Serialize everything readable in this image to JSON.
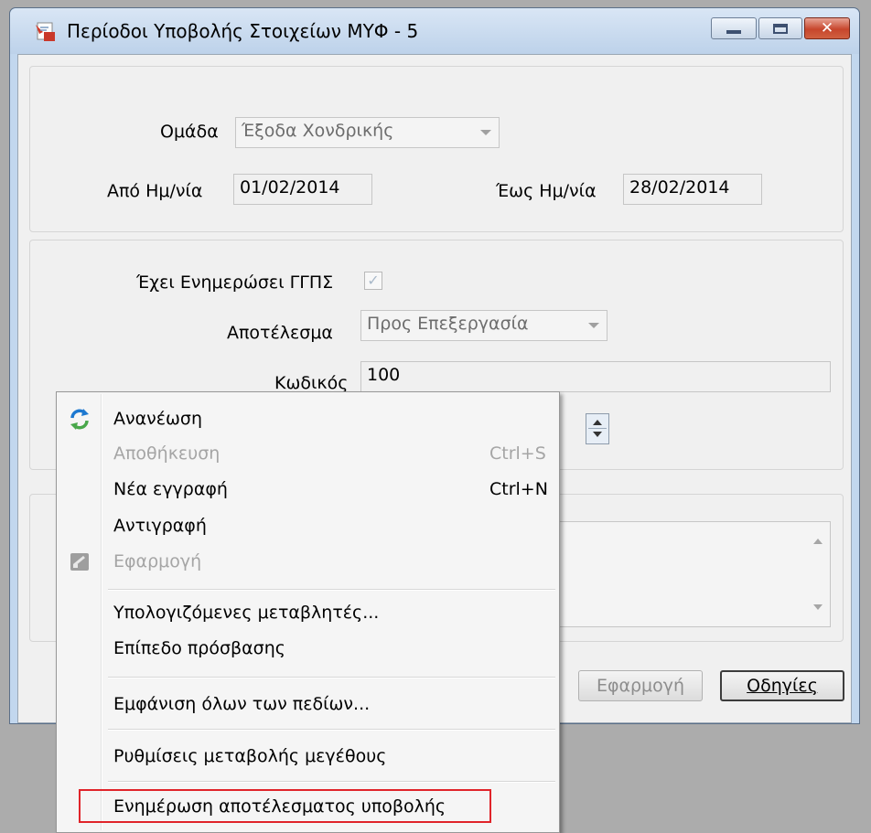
{
  "window": {
    "title": "Περίοδοι Υποβολής Στοιχείων ΜΥΦ - 5"
  },
  "form": {
    "group_label": "Ομάδα",
    "group_value": "Έξοδα Χονδρικής",
    "from_date_label": "Από Ημ/νία",
    "from_date_value": "01/02/2014",
    "to_date_label": "Έως Ημ/νία",
    "to_date_value": "28/02/2014",
    "updated_label": "Έχει Ενημερώσει ΓΓΠΣ",
    "updated_checked": true,
    "result_label": "Αποτέλεσμα",
    "result_value": "Προς Επεξεργασία",
    "code_label": "Κωδικός",
    "code_value": "100"
  },
  "buttons": {
    "apply_label": "Εφαρμογή",
    "help_label": "Οδηγίες"
  },
  "context_menu": {
    "items": [
      {
        "label": "Ανανέωση",
        "shortcut": "",
        "enabled": true,
        "icon": "refresh-icon"
      },
      {
        "label": "Αποθήκευση",
        "shortcut": "Ctrl+S",
        "enabled": false,
        "icon": ""
      },
      {
        "label": "Νέα εγγραφή",
        "shortcut": "Ctrl+N",
        "enabled": true,
        "icon": ""
      },
      {
        "label": "Αντιγραφή",
        "shortcut": "",
        "enabled": true,
        "icon": ""
      },
      {
        "label": "Εφαρμογή",
        "shortcut": "",
        "enabled": false,
        "icon": "apply-icon"
      },
      {
        "label": "Υπολογιζόμενες μεταβλητές...",
        "shortcut": "",
        "enabled": true,
        "icon": ""
      },
      {
        "label": "Επίπεδο πρόσβασης",
        "shortcut": "",
        "enabled": true,
        "icon": ""
      },
      {
        "label": "Εμφάνιση όλων των πεδίων...",
        "shortcut": "",
        "enabled": true,
        "icon": ""
      },
      {
        "label": "Ρυθμίσεις μεταβολής μεγέθους",
        "shortcut": "",
        "enabled": true,
        "icon": ""
      },
      {
        "label": "Ενημέρωση αποτέλεσματος υποβολής",
        "shortcut": "",
        "enabled": true,
        "icon": ""
      }
    ],
    "highlight_color": "#e0242a"
  }
}
